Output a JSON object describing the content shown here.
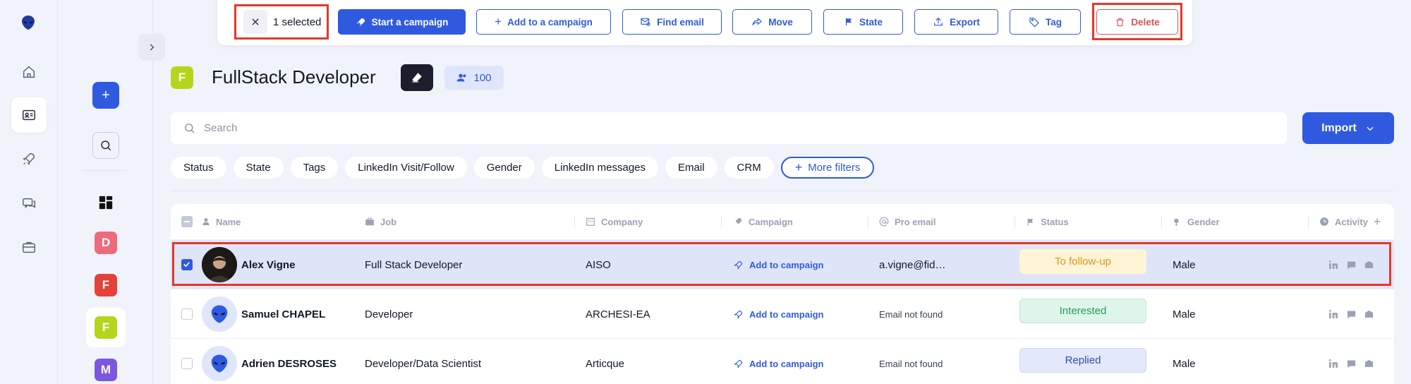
{
  "action_bar": {
    "selected_label": "1 selected",
    "buttons": [
      {
        "label": "Start a campaign",
        "icon": "rocket-icon",
        "style": "primary"
      },
      {
        "label": "Add to a campaign",
        "icon": "plus-icon",
        "style": "outline"
      },
      {
        "label": "Find email",
        "icon": "mail-search-icon",
        "style": "outline"
      },
      {
        "label": "Move",
        "icon": "share-arrow-icon",
        "style": "outline"
      },
      {
        "label": "State",
        "icon": "flag-icon",
        "style": "outline"
      },
      {
        "label": "Export",
        "icon": "upload-icon",
        "style": "outline"
      },
      {
        "label": "Tag",
        "icon": "tag-icon",
        "style": "outline"
      },
      {
        "label": "Delete",
        "icon": "trash-icon",
        "style": "danger"
      }
    ]
  },
  "sidebar": {
    "icons": [
      "alien-logo-icon",
      "home-icon",
      "contacts-icon",
      "rocket-icon",
      "chat-icon",
      "briefcase-icon"
    ],
    "active": "contacts-icon"
  },
  "lists": {
    "items": [
      {
        "letter": "D",
        "color": "#ee6b7d"
      },
      {
        "letter": "F",
        "color": "#e3413a"
      },
      {
        "letter": "F",
        "color": "#b5d51c"
      },
      {
        "letter": "M",
        "color": "#7b57e0"
      }
    ],
    "active_index": 2
  },
  "header": {
    "list_letter": "F",
    "list_color": "#b5d51c",
    "title": "FullStack Developer",
    "count": "100"
  },
  "search": {
    "placeholder": "Search"
  },
  "import_label": "Import",
  "filters": [
    "Status",
    "State",
    "Tags",
    "LinkedIn Visit/Follow",
    "Gender",
    "LinkedIn messages",
    "Email",
    "CRM"
  ],
  "more_filters_label": "More filters",
  "table": {
    "columns": [
      {
        "label": "Name",
        "icon": "person-icon"
      },
      {
        "label": "Job",
        "icon": "briefcase-icon"
      },
      {
        "label": "Company",
        "icon": "building-icon"
      },
      {
        "label": "Campaign",
        "icon": "rocket-icon"
      },
      {
        "label": "Pro email",
        "icon": "at-icon"
      },
      {
        "label": "Status",
        "icon": "flag-icon"
      },
      {
        "label": "Gender",
        "icon": "gender-icon"
      },
      {
        "label": "Activity",
        "icon": "clock-icon"
      }
    ],
    "rows": [
      {
        "checked": true,
        "avatar": "photo",
        "name": "Alex Vigne",
        "job": "Full Stack Developer",
        "company": "AISO",
        "campaign": "Add to campaign",
        "email": "a.vigne@fid…",
        "status": "To follow-up",
        "status_bg": "#fff4d6",
        "status_fg": "#e0951a",
        "gender": "Male"
      },
      {
        "checked": false,
        "avatar": "alien",
        "name": "Samuel CHAPEL",
        "job": "Developer",
        "company": "ARCHESI-EA",
        "campaign": "Add to campaign",
        "email": "Email not found",
        "status": "Interested",
        "status_bg": "#dff5ea",
        "status_fg": "#1f9d5a",
        "gender": "Male"
      },
      {
        "checked": false,
        "avatar": "alien",
        "name": "Adrien DESROSES",
        "job": "Developer/Data Scientist",
        "company": "Articque",
        "campaign": "Add to campaign",
        "email": "Email not found",
        "status": "Replied",
        "status_bg": "#e3e8fb",
        "status_fg": "#2f4fae",
        "gender": "Male"
      }
    ]
  },
  "colors": {
    "accent": "#2f5ae0",
    "highlight": "#e13a28",
    "danger": "#e05252"
  }
}
